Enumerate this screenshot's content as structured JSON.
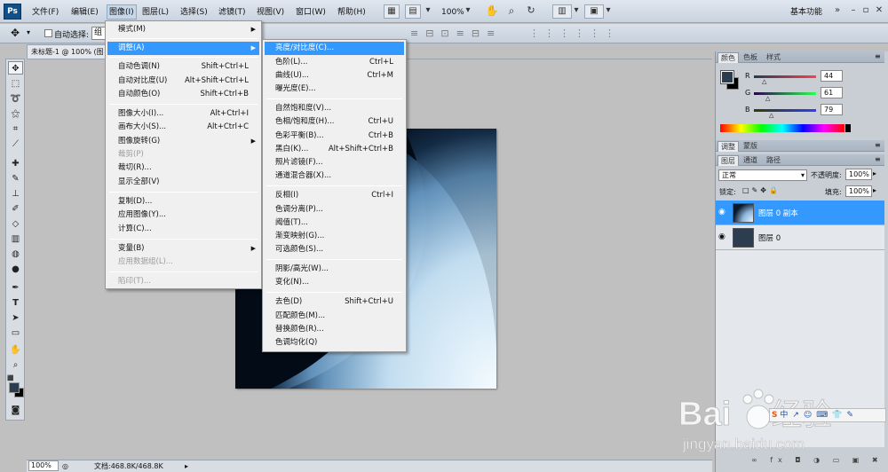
{
  "app": {
    "logo": "Ps",
    "workspace": "基本功能",
    "zoom": "100%"
  },
  "menubar": {
    "items": [
      "文件(F)",
      "编辑(E)",
      "图像(I)",
      "图层(L)",
      "选择(S)",
      "滤镜(T)",
      "视图(V)",
      "窗口(W)",
      "帮助(H)"
    ]
  },
  "optionsbar": {
    "auto_select_label": "自动选择:",
    "auto_select_value": "组"
  },
  "document": {
    "tab_title": "未标题-1 @ 100% (图"
  },
  "status": {
    "zoom": "100%",
    "doc_info": "文档:468.8K/468.8K"
  },
  "image_menu": {
    "items": [
      {
        "label": "模式(M)",
        "shortcut": "",
        "arrow": true,
        "disabled": false
      },
      {
        "label": "调整(A)",
        "shortcut": "",
        "arrow": true,
        "disabled": false,
        "highlight": true
      },
      {
        "label": "自动色调(N)",
        "shortcut": "Shift+Ctrl+L"
      },
      {
        "label": "自动对比度(U)",
        "shortcut": "Alt+Shift+Ctrl+L"
      },
      {
        "label": "自动颜色(O)",
        "shortcut": "Shift+Ctrl+B"
      },
      {
        "label": "图像大小(I)...",
        "shortcut": "Alt+Ctrl+I"
      },
      {
        "label": "画布大小(S)...",
        "shortcut": "Alt+Ctrl+C"
      },
      {
        "label": "图像旋转(G)",
        "shortcut": "",
        "arrow": true
      },
      {
        "label": "裁剪(P)",
        "shortcut": "",
        "disabled": true
      },
      {
        "label": "裁切(R)...",
        "shortcut": ""
      },
      {
        "label": "显示全部(V)",
        "shortcut": ""
      },
      {
        "label": "复制(D)...",
        "shortcut": ""
      },
      {
        "label": "应用图像(Y)...",
        "shortcut": ""
      },
      {
        "label": "计算(C)...",
        "shortcut": ""
      },
      {
        "label": "变量(B)",
        "shortcut": "",
        "arrow": true
      },
      {
        "label": "应用数据组(L)...",
        "shortcut": "",
        "disabled": true
      },
      {
        "label": "陷印(T)...",
        "shortcut": "",
        "disabled": true
      }
    ]
  },
  "adjust_menu": {
    "items": [
      {
        "label": "亮度/对比度(C)...",
        "shortcut": "",
        "highlight": true
      },
      {
        "label": "色阶(L)...",
        "shortcut": "Ctrl+L"
      },
      {
        "label": "曲线(U)...",
        "shortcut": "Ctrl+M"
      },
      {
        "label": "曝光度(E)...",
        "shortcut": ""
      },
      {
        "label": "自然饱和度(V)...",
        "shortcut": ""
      },
      {
        "label": "色相/饱和度(H)...",
        "shortcut": "Ctrl+U"
      },
      {
        "label": "色彩平衡(B)...",
        "shortcut": "Ctrl+B"
      },
      {
        "label": "黑白(K)...",
        "shortcut": "Alt+Shift+Ctrl+B"
      },
      {
        "label": "照片滤镜(F)...",
        "shortcut": ""
      },
      {
        "label": "通道混合器(X)...",
        "shortcut": ""
      },
      {
        "label": "反相(I)",
        "shortcut": "Ctrl+I"
      },
      {
        "label": "色调分离(P)...",
        "shortcut": ""
      },
      {
        "label": "阈值(T)...",
        "shortcut": ""
      },
      {
        "label": "渐变映射(G)...",
        "shortcut": ""
      },
      {
        "label": "可选颜色(S)...",
        "shortcut": ""
      },
      {
        "label": "阴影/高光(W)...",
        "shortcut": ""
      },
      {
        "label": "变化(N)...",
        "shortcut": ""
      },
      {
        "label": "去色(D)",
        "shortcut": "Shift+Ctrl+U"
      },
      {
        "label": "匹配颜色(M)...",
        "shortcut": ""
      },
      {
        "label": "替换颜色(R)...",
        "shortcut": ""
      },
      {
        "label": "色调均化(Q)",
        "shortcut": ""
      }
    ]
  },
  "color_panel": {
    "tabs": [
      "颜色",
      "色板",
      "样式"
    ],
    "r_label": "R",
    "g_label": "G",
    "b_label": "B",
    "r_value": "44",
    "g_value": "61",
    "b_value": "79",
    "foreground": "#2c3d4f",
    "background": "#000000"
  },
  "adjust_panel": {
    "tabs": [
      "调整",
      "蒙版"
    ]
  },
  "layers_panel": {
    "tabs": [
      "图层",
      "通道",
      "路径"
    ],
    "blend_mode": "正常",
    "opacity_label": "不透明度:",
    "opacity_value": "100%",
    "lock_label": "锁定:",
    "fill_label": "填充:",
    "fill_value": "100%",
    "layers": [
      {
        "name": "图层 0 副本",
        "selected": true
      },
      {
        "name": "图层 0",
        "selected": false
      }
    ]
  }
}
